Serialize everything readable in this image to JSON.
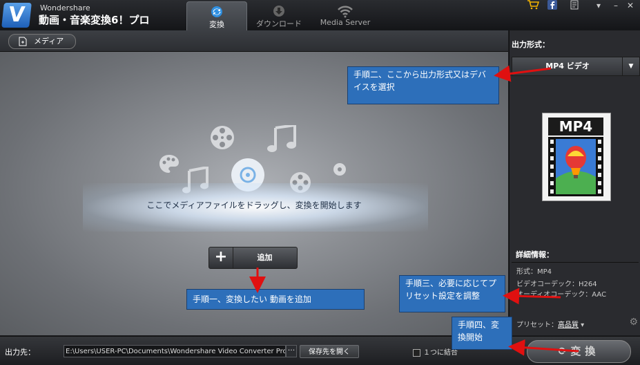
{
  "app": {
    "brand_small": "Wondershare",
    "brand_title": "動画・音楽変換6！プロ",
    "logo_letter": "V"
  },
  "tabs": [
    {
      "label": "変換",
      "icon": "refresh-icon",
      "active": true
    },
    {
      "label": "ダウンロード",
      "icon": "download-icon",
      "active": false
    },
    {
      "label": "Media Server",
      "icon": "wifi-icon",
      "active": false
    }
  ],
  "toolbar": {
    "media_label": "メディア",
    "media_icon": "add-file-icon"
  },
  "main": {
    "drop_hint": "ここでメディアファイルをドラッグし、変換を開始します",
    "add_label": "追加"
  },
  "right_panel": {
    "format_heading": "出力形式：",
    "selected_format": "MP4 ビデオ",
    "format_badge": "MP4",
    "details_heading": "詳細情報：",
    "details": [
      "形式：MP4",
      "ビデオコーデック：H264",
      "オーディオコーデック：AAC"
    ],
    "preset_label": "プリセット：",
    "preset_value": "高品質"
  },
  "bottom_bar": {
    "output_label": "出力先：",
    "output_path": "E:\\Users\\USER-PC\\Documents\\Wondershare Video Converter Pro\\Outpu",
    "browse_label": "···",
    "open_folder_label": "保存先を開く",
    "merge_label": "１つに結合",
    "convert_label": "変換"
  },
  "annotations": [
    {
      "text": "手順二、ここから出力形式又はデバイスを選択"
    },
    {
      "text": "手順一、変換したい 動画を追加"
    },
    {
      "text": "手順三、必要に応じてプリセット設定を調整"
    },
    {
      "text": "手順四、変換開始"
    }
  ],
  "colors": {
    "callout_bg": "#2d6fba",
    "arrow": "#e01010",
    "accent_blue": "#2d6fba"
  }
}
